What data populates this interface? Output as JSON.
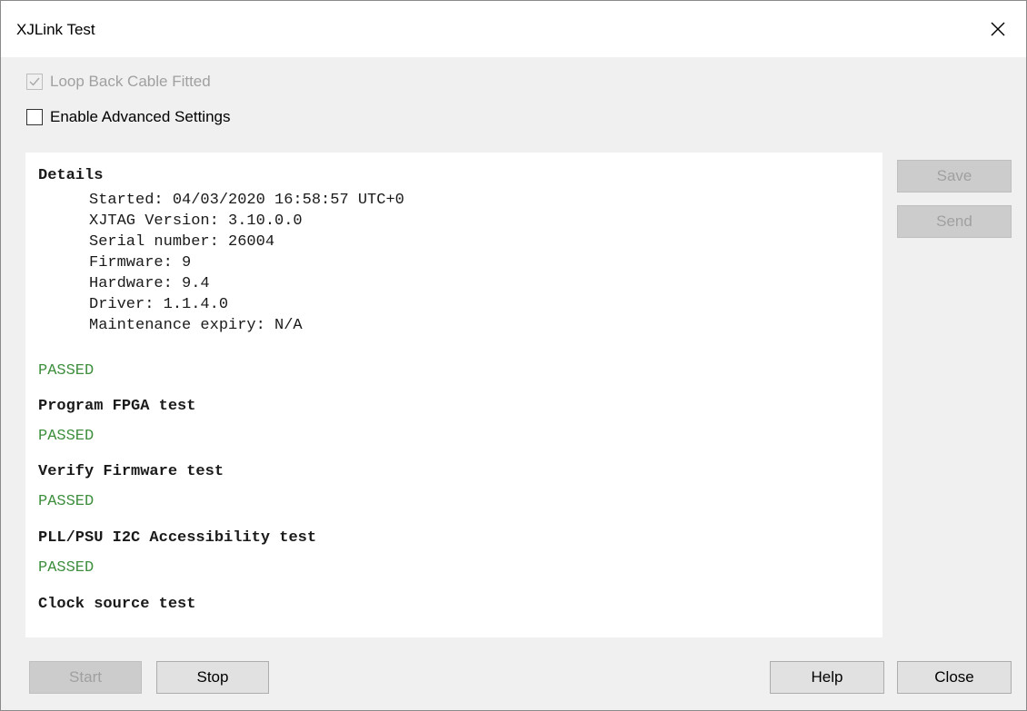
{
  "window": {
    "title": "XJLink Test"
  },
  "options": {
    "loopback_label": "Loop Back Cable Fitted",
    "loopback_checked": true,
    "advanced_label": "Enable Advanced Settings",
    "advanced_checked": false
  },
  "log": {
    "details_heading": "Details",
    "details": [
      "Started: 04/03/2020 16:58:57 UTC+0",
      "XJTAG Version: 3.10.0.0",
      "Serial number: 26004",
      "Firmware: 9",
      "Hardware: 9.4",
      "Driver: 1.1.4.0",
      "Maintenance expiry: N/A"
    ],
    "details_status": "PASSED",
    "tests": [
      {
        "name": "Program FPGA test",
        "status": "PASSED"
      },
      {
        "name": "Verify Firmware test",
        "status": "PASSED"
      },
      {
        "name": "PLL/PSU I2C Accessibility test",
        "status": "PASSED"
      },
      {
        "name": "Clock source test"
      }
    ],
    "pass_color": "#3f8f3f"
  },
  "side_buttons": {
    "save_label": "Save",
    "send_label": "Send"
  },
  "bottom_buttons": {
    "start_label": "Start",
    "stop_label": "Stop",
    "help_label": "Help",
    "close_label": "Close"
  }
}
